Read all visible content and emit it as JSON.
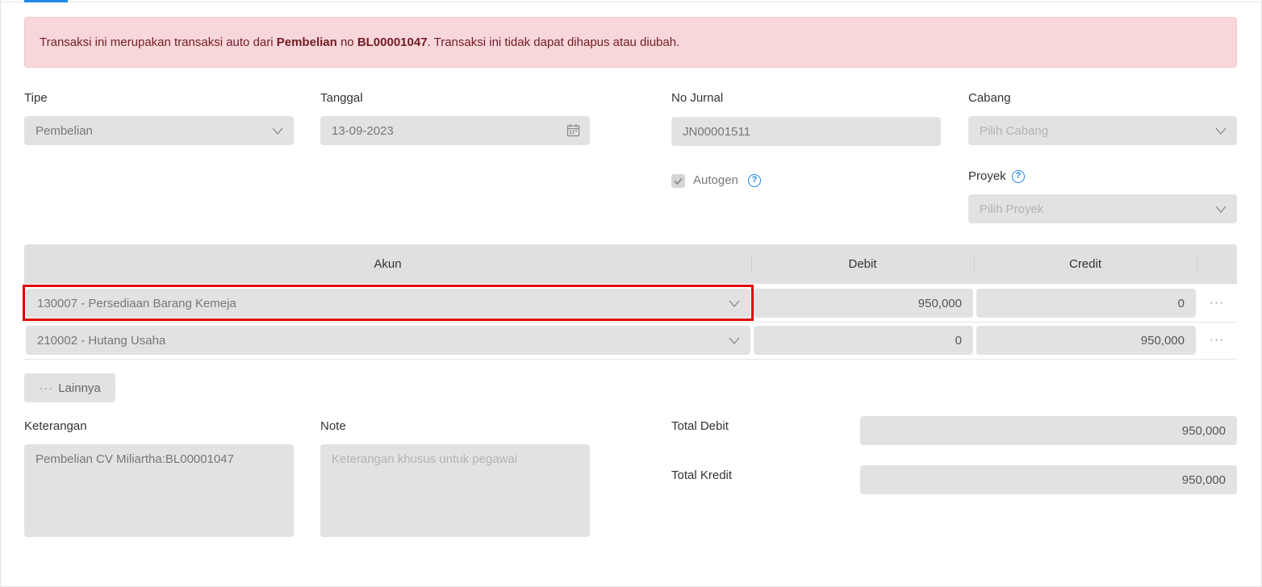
{
  "alert": {
    "prefix": "Transaksi ini merupakan transaksi auto dari ",
    "source": "Pembelian",
    "middle": " no ",
    "doc_no": "BL00001047",
    "suffix": ". Transaksi ini tidak dapat dihapus atau diubah."
  },
  "form": {
    "tipe_label": "Tipe",
    "tipe_value": "Pembelian",
    "tanggal_label": "Tanggal",
    "tanggal_value": "13-09-2023",
    "no_jurnal_label": "No Jurnal",
    "no_jurnal_value": "JN00001511",
    "cabang_label": "Cabang",
    "cabang_placeholder": "Pilih Cabang",
    "autogen_label": "Autogen",
    "proyek_label": "Proyek",
    "proyek_placeholder": "Pilih Proyek"
  },
  "table": {
    "headers": [
      "Akun",
      "Debit",
      "Credit"
    ],
    "rows": [
      {
        "akun": "130007 - Persediaan Barang Kemeja",
        "debit": "950,000",
        "credit": "0"
      },
      {
        "akun": "210002 - Hutang Usaha",
        "debit": "0",
        "credit": "950,000"
      }
    ],
    "more_button": "Lainnya"
  },
  "footer": {
    "keterangan_label": "Keterangan",
    "keterangan_value": "Pembelian CV Miliartha:BL00001047",
    "note_label": "Note",
    "note_placeholder": "Keterangan khusus untuk pegawai",
    "total_debit_label": "Total Debit",
    "total_debit_value": "950,000",
    "total_kredit_label": "Total Kredit",
    "total_kredit_value": "950,000"
  },
  "icons": {
    "chevron": "chevron-down-icon",
    "calendar": "calendar-icon",
    "help": "help-icon",
    "check": "check-icon",
    "more": "more-dots-icon"
  },
  "colors": {
    "alert_bg": "#f8d7da",
    "alert_text": "#721c24",
    "accent": "#1e88e5",
    "highlight": "#e00000"
  }
}
